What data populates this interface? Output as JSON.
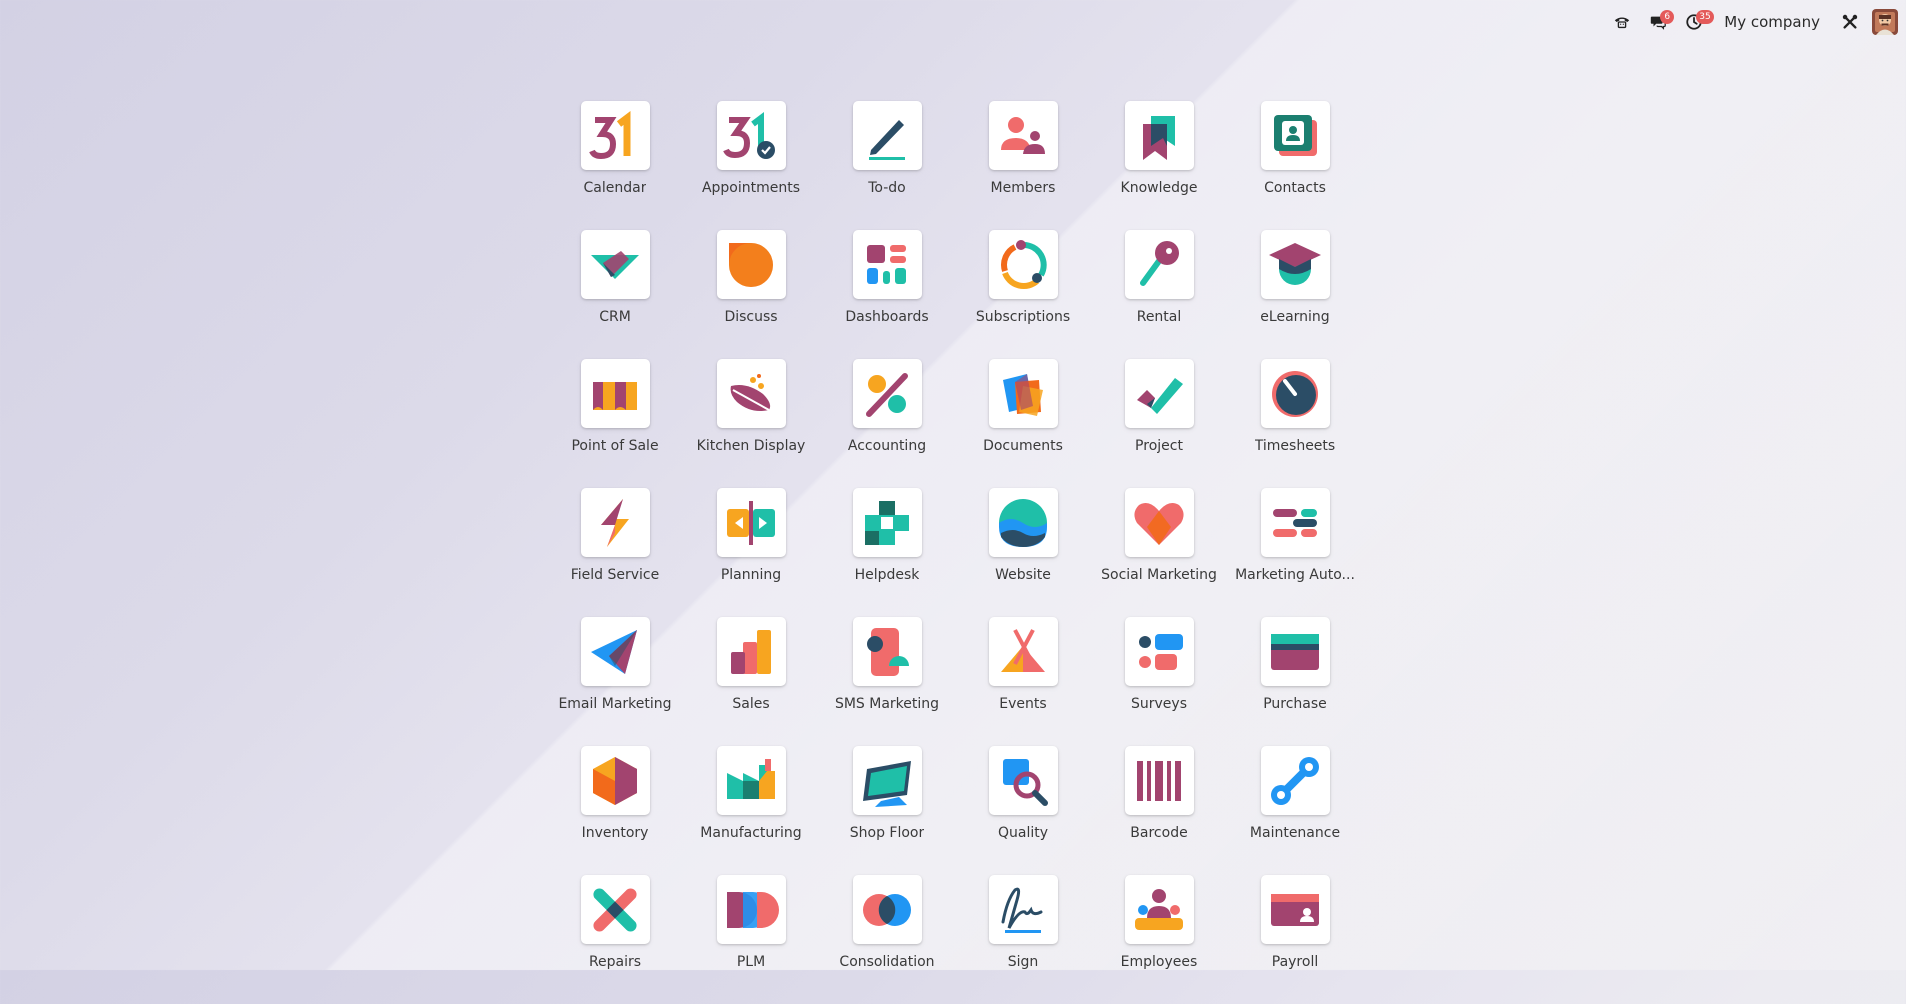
{
  "topbar": {
    "chat_badge": "6",
    "activity_badge": "35",
    "company": "My company"
  },
  "apps": [
    {
      "label": "Calendar",
      "icon": "calendar-icon"
    },
    {
      "label": "Appointments",
      "icon": "appointments-icon"
    },
    {
      "label": "To-do",
      "icon": "todo-icon"
    },
    {
      "label": "Members",
      "icon": "members-icon"
    },
    {
      "label": "Knowledge",
      "icon": "knowledge-icon"
    },
    {
      "label": "Contacts",
      "icon": "contacts-icon"
    },
    {
      "label": "CRM",
      "icon": "crm-icon"
    },
    {
      "label": "Discuss",
      "icon": "discuss-icon"
    },
    {
      "label": "Dashboards",
      "icon": "dashboards-icon"
    },
    {
      "label": "Subscriptions",
      "icon": "subscriptions-icon"
    },
    {
      "label": "Rental",
      "icon": "rental-icon"
    },
    {
      "label": "eLearning",
      "icon": "elearning-icon"
    },
    {
      "label": "Point of Sale",
      "icon": "point-of-sale-icon"
    },
    {
      "label": "Kitchen Display",
      "icon": "kitchen-display-icon"
    },
    {
      "label": "Accounting",
      "icon": "accounting-icon"
    },
    {
      "label": "Documents",
      "icon": "documents-icon"
    },
    {
      "label": "Project",
      "icon": "project-icon"
    },
    {
      "label": "Timesheets",
      "icon": "timesheets-icon"
    },
    {
      "label": "Field Service",
      "icon": "field-service-icon"
    },
    {
      "label": "Planning",
      "icon": "planning-icon"
    },
    {
      "label": "Helpdesk",
      "icon": "helpdesk-icon"
    },
    {
      "label": "Website",
      "icon": "website-icon"
    },
    {
      "label": "Social Marketing",
      "icon": "social-marketing-icon"
    },
    {
      "label": "Marketing Auto...",
      "icon": "marketing-automation-icon"
    },
    {
      "label": "Email Marketing",
      "icon": "email-marketing-icon"
    },
    {
      "label": "Sales",
      "icon": "sales-icon"
    },
    {
      "label": "SMS Marketing",
      "icon": "sms-marketing-icon"
    },
    {
      "label": "Events",
      "icon": "events-icon"
    },
    {
      "label": "Surveys",
      "icon": "surveys-icon"
    },
    {
      "label": "Purchase",
      "icon": "purchase-icon"
    },
    {
      "label": "Inventory",
      "icon": "inventory-icon"
    },
    {
      "label": "Manufacturing",
      "icon": "manufacturing-icon"
    },
    {
      "label": "Shop Floor",
      "icon": "shop-floor-icon"
    },
    {
      "label": "Quality",
      "icon": "quality-icon"
    },
    {
      "label": "Barcode",
      "icon": "barcode-icon"
    },
    {
      "label": "Maintenance",
      "icon": "maintenance-icon"
    },
    {
      "label": "Repairs",
      "icon": "repairs-icon"
    },
    {
      "label": "PLM",
      "icon": "plm-icon"
    },
    {
      "label": "Consolidation",
      "icon": "consolidation-icon"
    },
    {
      "label": "Sign",
      "icon": "sign-icon"
    },
    {
      "label": "Employees",
      "icon": "employees-icon"
    },
    {
      "label": "Payroll",
      "icon": "payroll-icon"
    }
  ]
}
